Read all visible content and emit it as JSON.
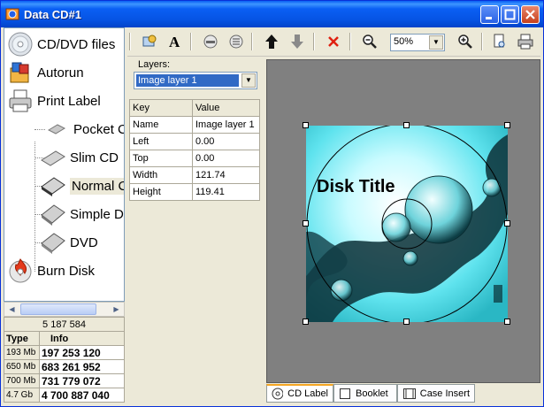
{
  "window": {
    "title": "Data CD#1"
  },
  "nav": {
    "items": [
      {
        "label": "CD/DVD files",
        "icon": "cd-disc-icon"
      },
      {
        "label": "Autorun",
        "icon": "autorun-icon"
      },
      {
        "label": "Print Label",
        "icon": "printer-icon"
      },
      {
        "label": "Pocket C",
        "icon": "pocket-case-icon"
      },
      {
        "label": "Slim CD",
        "icon": "slim-case-icon"
      },
      {
        "label": "Normal C",
        "icon": "normal-case-icon"
      },
      {
        "label": "Simple D",
        "icon": "simple-dvd-case-icon"
      },
      {
        "label": "DVD",
        "icon": "dvd-case-icon"
      },
      {
        "label": "Burn Disk",
        "icon": "burn-disc-icon"
      }
    ]
  },
  "sizes": {
    "total": "5 187 584",
    "headers": [
      "Type",
      "Info"
    ],
    "rows": [
      {
        "type": "193 Mb",
        "info": "197 253 120"
      },
      {
        "type": "650 Mb",
        "info": "683 261 952"
      },
      {
        "type": "700 Mb",
        "info": "731 779 072"
      },
      {
        "type": "4.7 Gb",
        "info": "4 700 887 040"
      }
    ]
  },
  "toolbar": {
    "zoom": "50%"
  },
  "layers": {
    "label": "Layers:",
    "selected": "Image layer 1",
    "headers": [
      "Key",
      "Value"
    ],
    "properties": [
      {
        "key": "Name",
        "value": "Image layer 1"
      },
      {
        "key": "Left",
        "value": "0.00"
      },
      {
        "key": "Top",
        "value": "0.00"
      },
      {
        "key": "Width",
        "value": "121.74"
      },
      {
        "key": "Height",
        "value": "119.41"
      }
    ]
  },
  "canvas": {
    "disk_title": "Disk Title"
  },
  "tabs": [
    {
      "label": "CD Label"
    },
    {
      "label": "Booklet"
    },
    {
      "label": "Case Insert"
    }
  ]
}
